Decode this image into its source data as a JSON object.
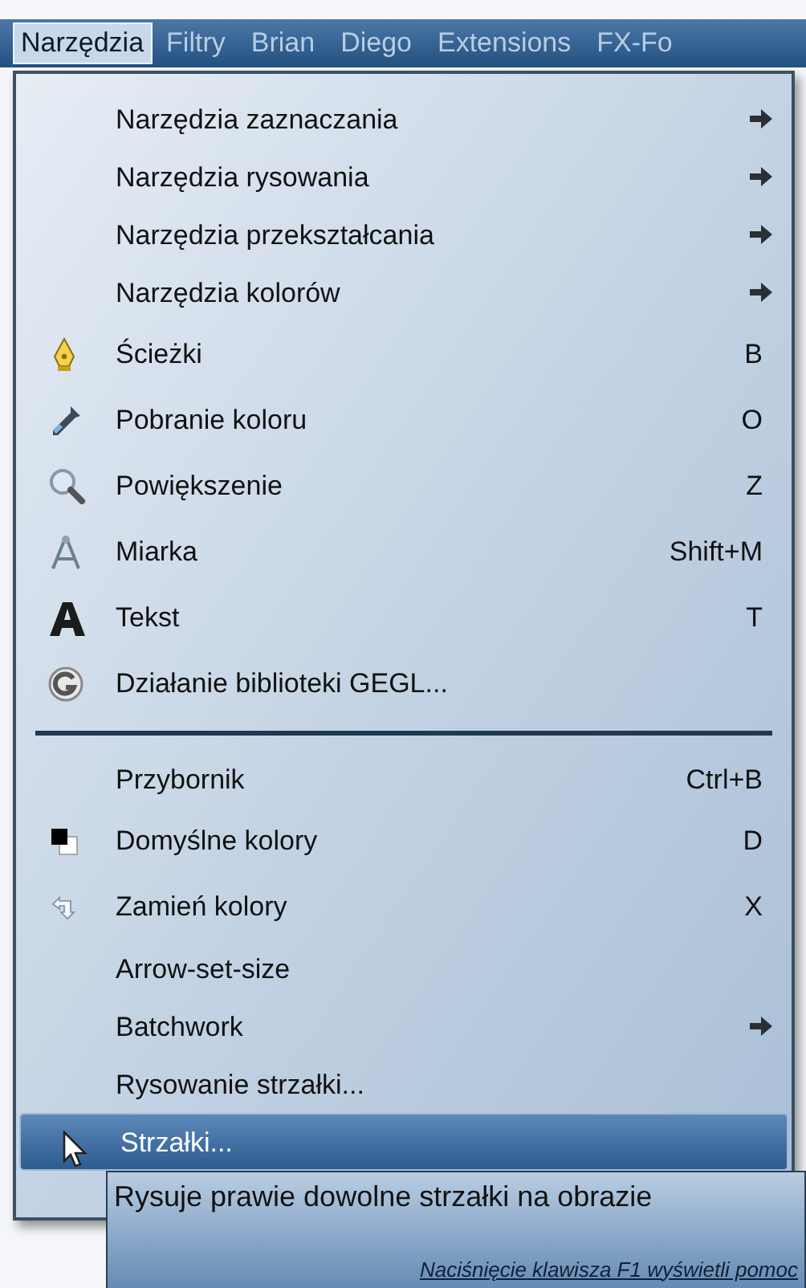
{
  "menubar": [
    {
      "label": "Narzędzia",
      "selected": true
    },
    {
      "label": "Filtry",
      "selected": false
    },
    {
      "label": "Brian",
      "selected": false
    },
    {
      "label": "Diego",
      "selected": false
    },
    {
      "label": "Extensions",
      "selected": false
    },
    {
      "label": "FX-Fo",
      "selected": false
    }
  ],
  "menu": [
    {
      "kind": "item",
      "label": "Narzędzia zaznaczania",
      "submenu": true,
      "selected": false
    },
    {
      "kind": "item",
      "label": "Narzędzia rysowania",
      "submenu": true,
      "selected": false
    },
    {
      "kind": "item",
      "label": "Narzędzia przekształcania",
      "submenu": true,
      "selected": false
    },
    {
      "kind": "item",
      "label": "Narzędzia kolorów",
      "submenu": true,
      "selected": false
    },
    {
      "kind": "item",
      "label": "Ścieżki",
      "shortcut": "B",
      "submenu": false,
      "selected": false
    },
    {
      "kind": "item",
      "label": "Pobranie koloru",
      "shortcut": "O",
      "submenu": false,
      "selected": false
    },
    {
      "kind": "item",
      "label": "Powiększenie",
      "shortcut": "Z",
      "submenu": false,
      "selected": false
    },
    {
      "kind": "item",
      "label": "Miarka",
      "shortcut": "Shift+M",
      "submenu": false,
      "selected": false
    },
    {
      "kind": "item",
      "label": "Tekst",
      "shortcut": "T",
      "submenu": false,
      "selected": false
    },
    {
      "kind": "item",
      "label": "Działanie biblioteki GEGL...",
      "submenu": false,
      "selected": false
    },
    {
      "kind": "separator"
    },
    {
      "kind": "item",
      "label": "Przybornik",
      "shortcut": "Ctrl+B",
      "submenu": false,
      "selected": false
    },
    {
      "kind": "item",
      "label": "Domyślne kolory",
      "shortcut": "D",
      "submenu": false,
      "selected": false
    },
    {
      "kind": "item",
      "label": "Zamień kolory",
      "shortcut": "X",
      "submenu": false,
      "selected": false
    },
    {
      "kind": "item",
      "label": "Arrow-set-size",
      "submenu": false,
      "selected": false
    },
    {
      "kind": "item",
      "label": "Batchwork",
      "submenu": true,
      "selected": false
    },
    {
      "kind": "item",
      "label": "Rysowanie strzałki...",
      "submenu": false,
      "selected": false
    },
    {
      "kind": "item",
      "label": "Strzałki...",
      "submenu": false,
      "selected": true
    }
  ],
  "tooltip": {
    "text": "Rysuje prawie dowolne strzałki na obrazie",
    "hint": "Naciśnięcie klawisza F1 wyświetli pomoc"
  }
}
